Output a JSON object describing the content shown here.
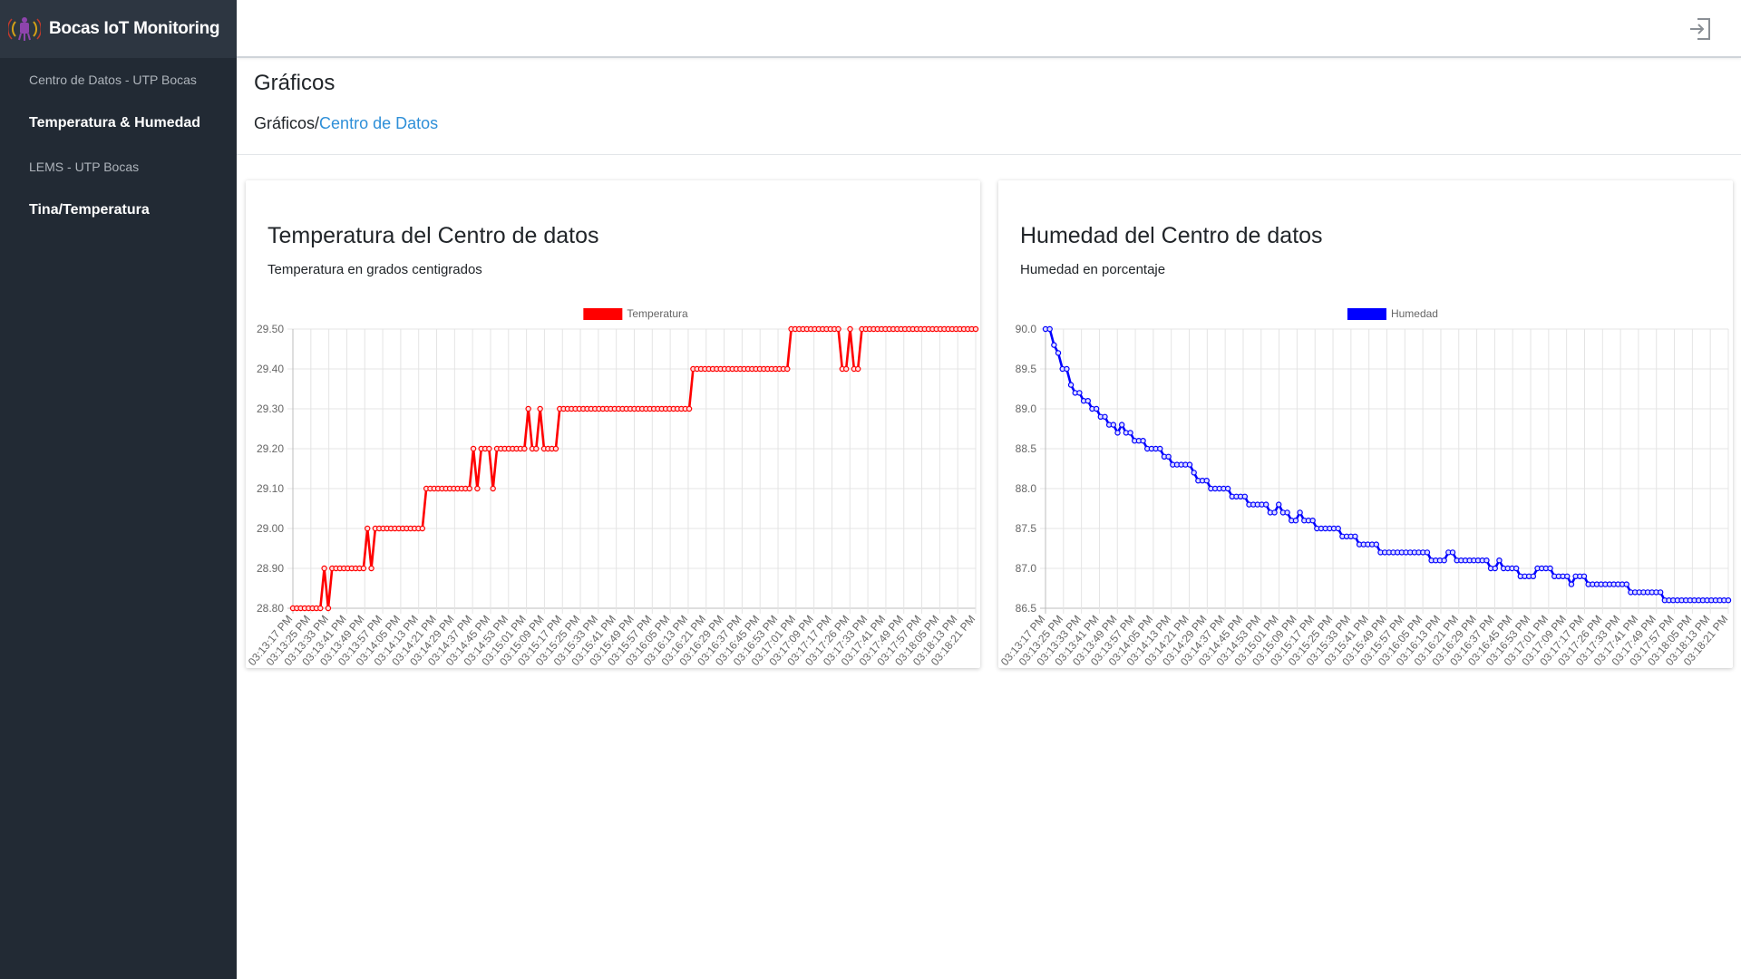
{
  "app": {
    "title": "Bocas IoT Monitoring",
    "logo_icon": "iot-satellite-logo-icon"
  },
  "sidebar": {
    "items": [
      {
        "type": "header",
        "label": "Centro de Datos - UTP Bocas"
      },
      {
        "type": "link",
        "label": "Temperatura & Humedad"
      },
      {
        "type": "header",
        "label": "LEMS - UTP Bocas"
      },
      {
        "type": "link",
        "label": "Tina/Temperatura"
      }
    ]
  },
  "topbar": {
    "logout_icon": "logout-icon"
  },
  "page": {
    "title": "Gráficos",
    "breadcrumb": {
      "root": "Gráficos",
      "separator": "/",
      "current": "Centro de Datos"
    }
  },
  "cards": {
    "temperature": {
      "title": "Temperatura del Centro de datos",
      "subtitle": "Temperatura en grados centigrados"
    },
    "humidity": {
      "title": "Humedad del Centro de datos",
      "subtitle": "Humedad en porcentaje"
    }
  },
  "colors": {
    "sidebar_bg": "#222a34",
    "brand_bg": "#2d3641",
    "link": "#2e8fd8",
    "temperature": "#ff0000",
    "humidity": "#0000ff"
  },
  "chart_data": [
    {
      "type": "line",
      "title": "",
      "legend": "Temperatura",
      "legend_position": "top",
      "color": "#ff0000",
      "grid": true,
      "ylim": [
        28.8,
        29.5
      ],
      "yticks": [
        "29.50",
        "29.40",
        "29.30",
        "29.20",
        "29.10",
        "29.00",
        "28.90",
        "28.80"
      ],
      "xticks": [
        "03:13:17 PM",
        "03:13:25 PM",
        "03:13:33 PM",
        "03:13:41 PM",
        "03:13:49 PM",
        "03:13:57 PM",
        "03:14:05 PM",
        "03:14:13 PM",
        "03:14:21 PM",
        "03:14:29 PM",
        "03:14:37 PM",
        "03:14:45 PM",
        "03:14:53 PM",
        "03:15:01 PM",
        "03:15:09 PM",
        "03:15:17 PM",
        "03:15:25 PM",
        "03:15:33 PM",
        "03:15:41 PM",
        "03:15:49 PM",
        "03:15:57 PM",
        "03:16:05 PM",
        "03:16:13 PM",
        "03:16:21 PM",
        "03:16:29 PM",
        "03:16:37 PM",
        "03:16:45 PM",
        "03:16:53 PM",
        "03:17:01 PM",
        "03:17:09 PM",
        "03:17:17 PM",
        "03:17:26 PM",
        "03:17:33 PM",
        "03:17:41 PM",
        "03:17:49 PM",
        "03:17:57 PM",
        "03:18:05 PM",
        "03:18:13 PM",
        "03:18:21 PM"
      ],
      "series": [
        {
          "name": "Temperatura",
          "values": [
            28.8,
            28.8,
            28.8,
            28.8,
            28.8,
            28.8,
            28.8,
            28.8,
            28.9,
            28.8,
            28.9,
            28.9,
            28.9,
            28.9,
            28.9,
            28.9,
            28.9,
            28.9,
            28.9,
            29.0,
            28.9,
            29.0,
            29.0,
            29.0,
            29.0,
            29.0,
            29.0,
            29.0,
            29.0,
            29.0,
            29.0,
            29.0,
            29.0,
            29.0,
            29.1,
            29.1,
            29.1,
            29.1,
            29.1,
            29.1,
            29.1,
            29.1,
            29.1,
            29.1,
            29.1,
            29.1,
            29.2,
            29.1,
            29.2,
            29.2,
            29.2,
            29.1,
            29.2,
            29.2,
            29.2,
            29.2,
            29.2,
            29.2,
            29.2,
            29.2,
            29.3,
            29.2,
            29.2,
            29.3,
            29.2,
            29.2,
            29.2,
            29.2,
            29.3,
            29.3,
            29.3,
            29.3,
            29.3,
            29.3,
            29.3,
            29.3,
            29.3,
            29.3,
            29.3,
            29.3,
            29.3,
            29.3,
            29.3,
            29.3,
            29.3,
            29.3,
            29.3,
            29.3,
            29.3,
            29.3,
            29.3,
            29.3,
            29.3,
            29.3,
            29.3,
            29.3,
            29.3,
            29.3,
            29.3,
            29.3,
            29.3,
            29.3,
            29.4,
            29.4,
            29.4,
            29.4,
            29.4,
            29.4,
            29.4,
            29.4,
            29.4,
            29.4,
            29.4,
            29.4,
            29.4,
            29.4,
            29.4,
            29.4,
            29.4,
            29.4,
            29.4,
            29.4,
            29.4,
            29.4,
            29.4,
            29.4,
            29.4,
            29.5,
            29.5,
            29.5,
            29.5,
            29.5,
            29.5,
            29.5,
            29.5,
            29.5,
            29.5,
            29.5,
            29.5,
            29.5,
            29.4,
            29.4,
            29.5,
            29.4,
            29.4,
            29.5,
            29.5,
            29.5,
            29.5,
            29.5,
            29.5,
            29.5,
            29.5,
            29.5,
            29.5,
            29.5,
            29.5,
            29.5,
            29.5,
            29.5,
            29.5,
            29.5,
            29.5,
            29.5,
            29.5,
            29.5,
            29.5,
            29.5,
            29.5,
            29.5,
            29.5,
            29.5,
            29.5,
            29.5,
            29.5
          ]
        }
      ]
    },
    {
      "type": "line",
      "title": "",
      "legend": "Humedad",
      "legend_position": "top",
      "color": "#0000ff",
      "grid": true,
      "ylim": [
        86.5,
        90.0
      ],
      "yticks": [
        "90.0",
        "89.5",
        "89.0",
        "88.5",
        "88.0",
        "87.5",
        "87.0",
        "86.5"
      ],
      "xticks": [
        "03:13:17 PM",
        "03:13:25 PM",
        "03:13:33 PM",
        "03:13:41 PM",
        "03:13:49 PM",
        "03:13:57 PM",
        "03:14:05 PM",
        "03:14:13 PM",
        "03:14:21 PM",
        "03:14:29 PM",
        "03:14:37 PM",
        "03:14:45 PM",
        "03:14:53 PM",
        "03:15:01 PM",
        "03:15:09 PM",
        "03:15:17 PM",
        "03:15:25 PM",
        "03:15:33 PM",
        "03:15:41 PM",
        "03:15:49 PM",
        "03:15:57 PM",
        "03:16:05 PM",
        "03:16:13 PM",
        "03:16:21 PM",
        "03:16:29 PM",
        "03:16:37 PM",
        "03:16:45 PM",
        "03:16:53 PM",
        "03:17:01 PM",
        "03:17:09 PM",
        "03:17:17 PM",
        "03:17:26 PM",
        "03:17:33 PM",
        "03:17:41 PM",
        "03:17:49 PM",
        "03:17:57 PM",
        "03:18:05 PM",
        "03:18:13 PM",
        "03:18:21 PM"
      ],
      "series": [
        {
          "name": "Humedad",
          "values": [
            90.0,
            90.0,
            89.8,
            89.7,
            89.5,
            89.5,
            89.3,
            89.2,
            89.2,
            89.1,
            89.1,
            89.0,
            89.0,
            88.9,
            88.9,
            88.8,
            88.8,
            88.7,
            88.8,
            88.7,
            88.7,
            88.6,
            88.6,
            88.6,
            88.5,
            88.5,
            88.5,
            88.5,
            88.4,
            88.4,
            88.3,
            88.3,
            88.3,
            88.3,
            88.3,
            88.2,
            88.1,
            88.1,
            88.1,
            88.0,
            88.0,
            88.0,
            88.0,
            88.0,
            87.9,
            87.9,
            87.9,
            87.9,
            87.8,
            87.8,
            87.8,
            87.8,
            87.8,
            87.7,
            87.7,
            87.8,
            87.7,
            87.7,
            87.6,
            87.6,
            87.7,
            87.6,
            87.6,
            87.6,
            87.5,
            87.5,
            87.5,
            87.5,
            87.5,
            87.5,
            87.4,
            87.4,
            87.4,
            87.4,
            87.3,
            87.3,
            87.3,
            87.3,
            87.3,
            87.2,
            87.2,
            87.2,
            87.2,
            87.2,
            87.2,
            87.2,
            87.2,
            87.2,
            87.2,
            87.2,
            87.2,
            87.1,
            87.1,
            87.1,
            87.1,
            87.2,
            87.2,
            87.1,
            87.1,
            87.1,
            87.1,
            87.1,
            87.1,
            87.1,
            87.1,
            87.0,
            87.0,
            87.1,
            87.0,
            87.0,
            87.0,
            87.0,
            86.9,
            86.9,
            86.9,
            86.9,
            87.0,
            87.0,
            87.0,
            87.0,
            86.9,
            86.9,
            86.9,
            86.9,
            86.8,
            86.9,
            86.9,
            86.9,
            86.8,
            86.8,
            86.8,
            86.8,
            86.8,
            86.8,
            86.8,
            86.8,
            86.8,
            86.8,
            86.7,
            86.7,
            86.7,
            86.7,
            86.7,
            86.7,
            86.7,
            86.7,
            86.6,
            86.6,
            86.6,
            86.6,
            86.6,
            86.6,
            86.6,
            86.6,
            86.6,
            86.6,
            86.6,
            86.6,
            86.6,
            86.6,
            86.6,
            86.6
          ]
        }
      ]
    }
  ]
}
